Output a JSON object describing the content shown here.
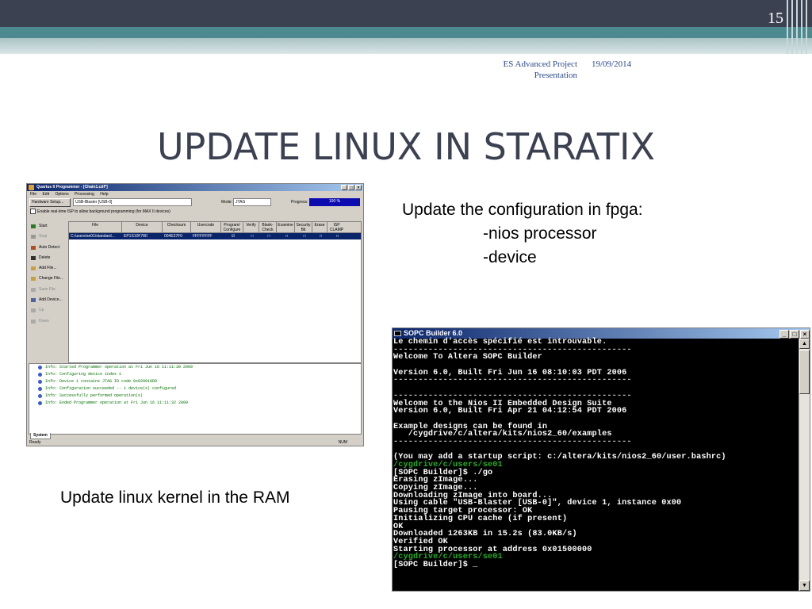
{
  "slide": {
    "number": "15",
    "footer_left_1": "ES Advanced Project",
    "footer_left_2": "Presentation",
    "footer_right": "19/09/2014",
    "title": "UPDATE LINUX IN STARATIX",
    "bullet": "Update the configuration in fpga:",
    "sub_items": [
      "-nios processor",
      "-device"
    ],
    "caption_left": "Update linux kernel in the RAM",
    "colors": {
      "header_dark": "#3c4152",
      "header_teal": "#4d8a8f",
      "title": "#3c4152"
    }
  },
  "quartus": {
    "window_title": "Quartus II Programmer - [Chain1.cdf*]",
    "menu": [
      "File",
      "Edit",
      "Options",
      "Processing",
      "Help"
    ],
    "hardware_setup_label": "Hardware Setup...",
    "hardware_value": "USB-Blaster [USB-0]",
    "mode_label": "Mode:",
    "mode_value": "JTAG",
    "progress_label": "Progress:",
    "progress_value": "100 %",
    "progress_fraction": 1.0,
    "isp_checkbox_label": "Enable real-time ISP to allow background programming (for MAX II devices)",
    "side_buttons": [
      {
        "label": "Start",
        "icon": "start-icon",
        "disabled": false
      },
      {
        "label": "Stop",
        "icon": "stop-icon",
        "disabled": true
      },
      {
        "label": "Auto Detect",
        "icon": "auto-detect-icon",
        "disabled": false
      },
      {
        "label": "Delete",
        "icon": "delete-icon",
        "disabled": false
      },
      {
        "label": "Add File...",
        "icon": "add-file-icon",
        "disabled": false
      },
      {
        "label": "Change File...",
        "icon": "change-file-icon",
        "disabled": false
      },
      {
        "label": "Save File",
        "icon": "save-file-icon",
        "disabled": true
      },
      {
        "label": "Add Device...",
        "icon": "add-device-icon",
        "disabled": false
      },
      {
        "label": "Up",
        "icon": "up-icon",
        "disabled": true
      },
      {
        "label": "Down",
        "icon": "down-icon",
        "disabled": true
      }
    ],
    "columns": [
      "File",
      "Device",
      "Checksum",
      "Usercode",
      "Program/ Configure",
      "Verify",
      "Blank- Check",
      "Examine",
      "Security Bit",
      "Erase",
      "ISP CLAMP"
    ],
    "row": {
      "file": "C:/users/se01/standard...",
      "device": "EP1S10F780",
      "checksum": "004E37F0",
      "usercode": "FFFFFFFF"
    },
    "messages": [
      "Info: Started Programmer operation at Fri Jun 16 11:11:30 2009",
      "Info: Configuring device index 1",
      "Info: Device 1 contains JTAG ID code 0x020010DD",
      "Info: Configuration succeeded -- 1 device(s) configured",
      "Info: Successfully performed operation(s)",
      "Info: Ended Programmer operation at Fri Jun 16 11:11:32 2009"
    ],
    "message_tab": "System",
    "status_text": "Ready",
    "status_num": "NUM"
  },
  "sopc": {
    "window_title": "SOPC Builder 6.0",
    "lines": [
      {
        "text": "Le chemin d'accès spécifié est introuvable.",
        "style": "normal"
      },
      {
        "text": "------------------------------------------------",
        "style": "rule"
      },
      {
        "text": "Welcome To Altera SOPC Builder",
        "style": "normal"
      },
      {
        "text": "",
        "style": "normal"
      },
      {
        "text": "Version 6.0, Built Fri Jun 16 08:10:03 PDT 2006",
        "style": "normal"
      },
      {
        "text": "------------------------------------------------",
        "style": "rule"
      },
      {
        "text": "",
        "style": "normal"
      },
      {
        "text": "------------------------------------------------",
        "style": "rule"
      },
      {
        "text": "Welcome to the Nios II Embedded Design Suite",
        "style": "normal"
      },
      {
        "text": "Version 6.0, Built Fri Apr 21 04:12:54 PDT 2006",
        "style": "normal"
      },
      {
        "text": "",
        "style": "normal"
      },
      {
        "text": "Example designs can be found in",
        "style": "normal"
      },
      {
        "text": "   /cygdrive/c/altera/kits/nios2_60/examples",
        "style": "normal"
      },
      {
        "text": "------------------------------------------------",
        "style": "rule"
      },
      {
        "text": "",
        "style": "normal"
      },
      {
        "text": "(You may add a startup script: c:/altera/kits/nios2_60/user.bashrc)",
        "style": "normal"
      },
      {
        "text": "/cygdrive/c/users/se01",
        "style": "green"
      },
      {
        "text": "[SOPC Builder]$ ./go",
        "style": "normal"
      },
      {
        "text": "Erasing zImage...",
        "style": "normal"
      },
      {
        "text": "Copying zImage...",
        "style": "normal"
      },
      {
        "text": "Downloading zImage into board...",
        "style": "normal"
      },
      {
        "text": "Using cable \"USB-Blaster [USB-0]\", device 1, instance 0x00",
        "style": "normal"
      },
      {
        "text": "Pausing target processor: OK",
        "style": "normal"
      },
      {
        "text": "Initializing CPU cache (if present)",
        "style": "normal"
      },
      {
        "text": "OK",
        "style": "normal"
      },
      {
        "text": "Downloaded 1263KB in 15.2s (83.0KB/s)",
        "style": "normal"
      },
      {
        "text": "Verified OK",
        "style": "normal"
      },
      {
        "text": "Starting processor at address 0x01500000",
        "style": "normal"
      },
      {
        "text": "/cygdrive/c/users/se01",
        "style": "green"
      },
      {
        "text": "[SOPC Builder]$ _",
        "style": "normal"
      }
    ]
  }
}
